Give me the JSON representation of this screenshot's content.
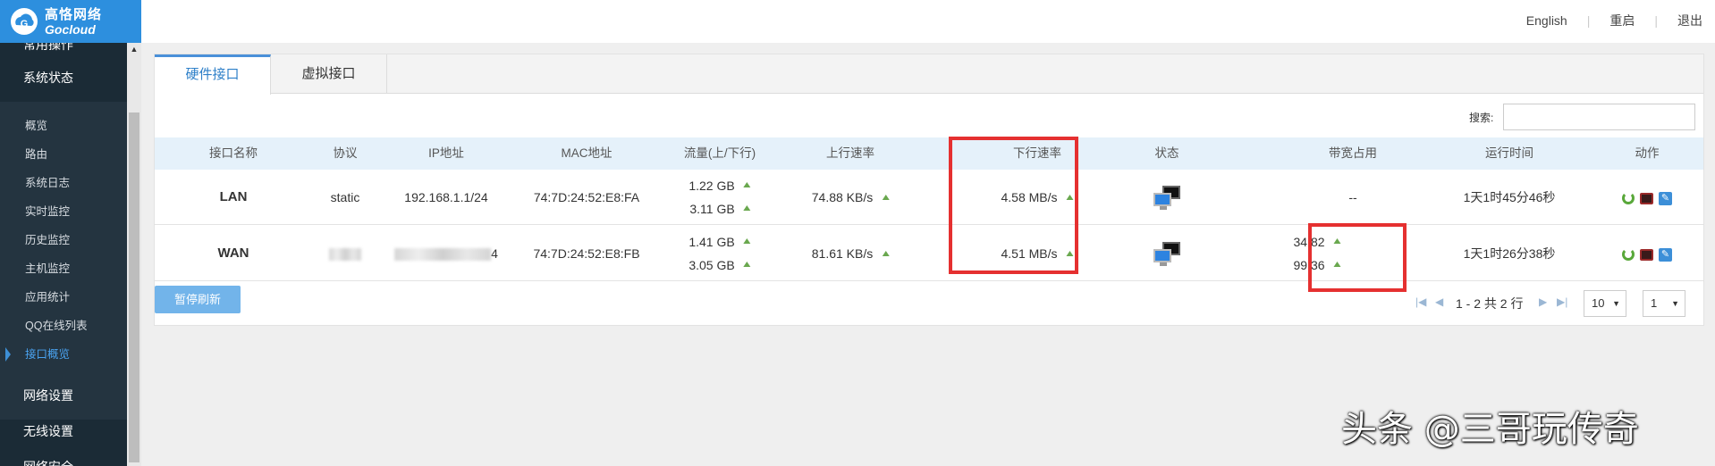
{
  "brand": {
    "name_cn": "高恪网络",
    "name_en": "Gocloud",
    "color": "#2d8fde"
  },
  "top_nav": {
    "english": "English",
    "reboot": "重启",
    "logout": "退出"
  },
  "sidebar": {
    "sections": [
      {
        "label": "常用操作"
      },
      {
        "label": "系统状态"
      },
      {
        "label": "网络设置"
      },
      {
        "label": "无线设置"
      },
      {
        "label": "网络安全"
      }
    ],
    "status_items": [
      {
        "label": "概览"
      },
      {
        "label": "路由"
      },
      {
        "label": "系统日志"
      },
      {
        "label": "实时监控"
      },
      {
        "label": "历史监控"
      },
      {
        "label": "主机监控"
      },
      {
        "label": "应用统计"
      },
      {
        "label": "QQ在线列表"
      },
      {
        "label": "接口概览",
        "active": true
      }
    ]
  },
  "tabs": [
    {
      "label": "硬件接口",
      "active": true
    },
    {
      "label": "虚拟接口",
      "active": false
    }
  ],
  "search": {
    "label": "搜索:",
    "value": "",
    "placeholder": ""
  },
  "table": {
    "headers": [
      "接口名称",
      "协议",
      "IP地址",
      "MAC地址",
      "流量(上/下行)",
      "上行速率",
      "下行速率",
      "状态",
      "带宽占用",
      "运行时间",
      "动作"
    ],
    "rows": [
      {
        "name": "LAN",
        "protocol": "static",
        "ip": "192.168.1.1/24",
        "mac": "74:7D:24:52:E8:FA",
        "traffic_up": "1.22 GB",
        "traffic_down": "3.11 GB",
        "up_rate": "74.88 KB/s",
        "down_rate": "4.58 MB/s",
        "status_icon": "network-computers-icon",
        "bandwidth": "--",
        "uptime": "1天1时45分46秒"
      },
      {
        "name": "WAN",
        "protocol": "",
        "ip_suffix": "4",
        "mac": "74:7D:24:52:E8:FB",
        "traffic_up": "1.41 GB",
        "traffic_down": "3.05 GB",
        "up_rate": "81.61 KB/s",
        "down_rate": "4.51 MB/s",
        "status_icon": "network-computers-icon",
        "bandwidth_up": "34.82",
        "bandwidth_down": "99.36",
        "uptime": "1天1时26分38秒"
      }
    ]
  },
  "pause_button": "暂停刷新",
  "pager": {
    "info": "1 - 2 共 2 行",
    "page_size": "10",
    "page": "1"
  },
  "watermark": "头条 @三哥玩传奇",
  "highlight_color": "#e53030"
}
